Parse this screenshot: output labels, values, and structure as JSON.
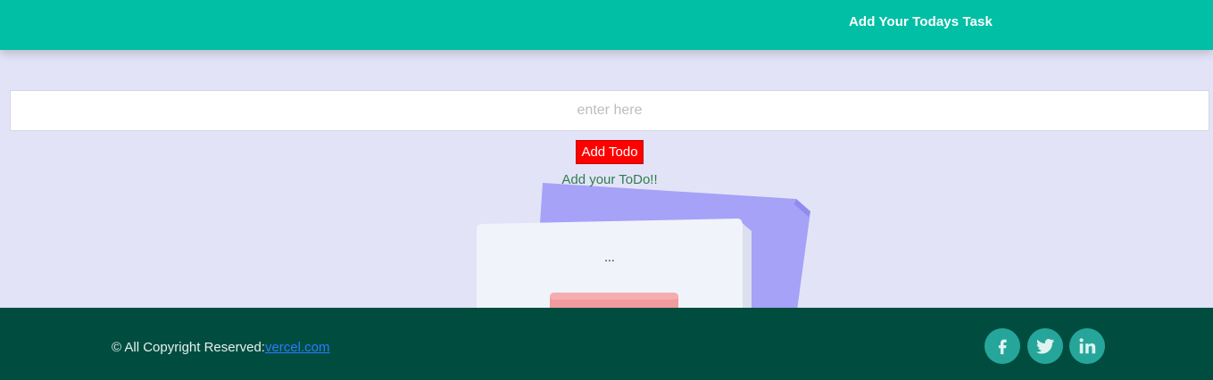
{
  "header": {
    "title": "Add Your Todays Task"
  },
  "form": {
    "input_placeholder": "enter here",
    "input_value": "",
    "add_button_label": "Add Todo"
  },
  "todos": {
    "empty_message": "Add your ToDo!!",
    "illustration_text": "..."
  },
  "footer": {
    "copyright_text": "© All Copyright Reserved:",
    "link_text": "vercel.com",
    "social": [
      "facebook-icon",
      "twitter-icon",
      "linkedin-icon"
    ]
  },
  "colors": {
    "header_bg": "#00bfa5",
    "page_bg": "#e3e3f7",
    "button_bg": "#ff0000",
    "footer_bg": "#004d40",
    "social_bg": "#26a69a"
  }
}
